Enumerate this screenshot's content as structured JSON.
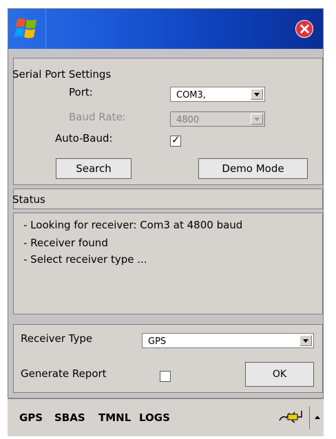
{
  "window": {
    "close_icon": "close-icon",
    "start_icon": "windows-flag-icon"
  },
  "serial": {
    "section_title": "Serial Port Settings",
    "port_label": "Port:",
    "port_value": "COM3,",
    "baud_label": "Baud Rate:",
    "baud_value": "4800",
    "autobaud_label": "Auto-Baud:",
    "autobaud_checked": true,
    "search_label": "Search",
    "demo_label": "Demo Mode"
  },
  "status": {
    "title": "Status",
    "lines": [
      "- Looking for receiver: Com3 at 4800 baud",
      "- Receiver found",
      "- Select receiver type ..."
    ]
  },
  "receiver": {
    "type_label": "Receiver Type",
    "type_value": "GPS",
    "report_label": "Generate Report",
    "report_checked": false,
    "ok_label": "OK"
  },
  "nav": {
    "items": [
      "GPS",
      "SBAS",
      "TMNL",
      "LOGS"
    ]
  },
  "colors": {
    "title_blue": "#1c5ad7",
    "panel_gray": "#d6d3ce",
    "close_red": "#e4323b"
  }
}
